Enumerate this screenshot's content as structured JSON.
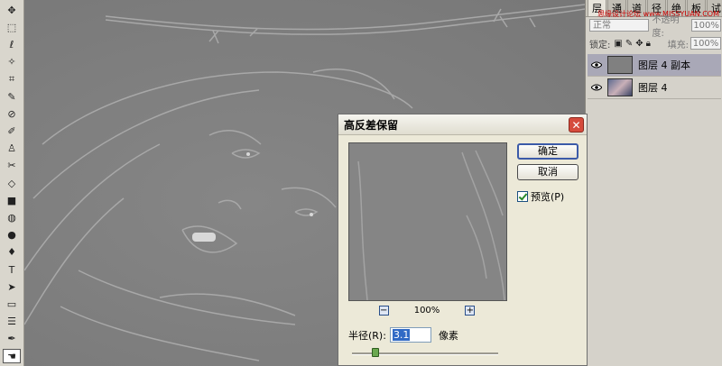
{
  "toolbox": {
    "tools": [
      {
        "name": "move-tool-icon",
        "glyph": "✥"
      },
      {
        "name": "marquee-tool-icon",
        "glyph": "⬚"
      },
      {
        "name": "lasso-tool-icon",
        "glyph": "ℓ"
      },
      {
        "name": "magic-wand-tool-icon",
        "glyph": "✧"
      },
      {
        "name": "crop-tool-icon",
        "glyph": "⌗"
      },
      {
        "name": "slice-tool-icon",
        "glyph": "✎"
      },
      {
        "name": "healing-brush-tool-icon",
        "glyph": "⊘"
      },
      {
        "name": "brush-tool-icon",
        "glyph": "✐"
      },
      {
        "name": "clone-stamp-tool-icon",
        "glyph": "♙"
      },
      {
        "name": "history-brush-tool-icon",
        "glyph": "✂"
      },
      {
        "name": "eraser-tool-icon",
        "glyph": "◇"
      },
      {
        "name": "gradient-tool-icon",
        "glyph": "■"
      },
      {
        "name": "blur-tool-icon",
        "glyph": "◍"
      },
      {
        "name": "dodge-tool-icon",
        "glyph": "●"
      },
      {
        "name": "pen-tool-icon",
        "glyph": "♦"
      },
      {
        "name": "type-tool-icon",
        "glyph": "T"
      },
      {
        "name": "path-selection-tool-icon",
        "glyph": "➤"
      },
      {
        "name": "shape-tool-icon",
        "glyph": "▭"
      },
      {
        "name": "notes-tool-icon",
        "glyph": "☰"
      },
      {
        "name": "eyedropper-tool-icon",
        "glyph": "✒"
      },
      {
        "name": "hand-tool-icon",
        "glyph": "☚"
      }
    ]
  },
  "panel": {
    "tabs": [
      "图层",
      "通",
      "道",
      "径",
      "绝",
      "板",
      "试"
    ],
    "blend_mode": "正常",
    "opacity_label": "不透明度:",
    "opacity_value": "100%",
    "lock_label": "锁定:",
    "fill_label": "填充:",
    "fill_value": "100%",
    "watermark": "思缘设计论坛 www.MISSYUAN.COM",
    "layers": [
      {
        "name": "图层 4 副本",
        "selected": true
      },
      {
        "name": "图层 4",
        "selected": false
      }
    ]
  },
  "dialog": {
    "title": "高反差保留",
    "ok_label": "确定",
    "cancel_label": "取消",
    "preview_label": "预览(P)",
    "preview_checked": true,
    "zoom_minus": "−",
    "zoom_plus": "+",
    "zoom_value": "100%",
    "radius_label": "半径(R):",
    "radius_value": "3.1",
    "radius_unit": "像素",
    "slider_fraction": 0.16
  }
}
